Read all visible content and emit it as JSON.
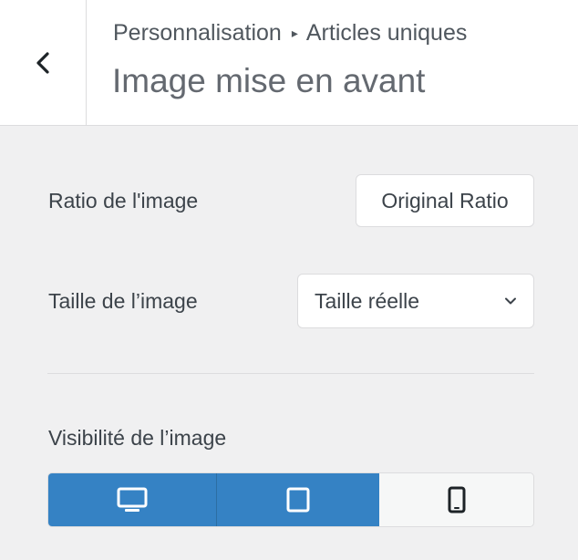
{
  "header": {
    "breadcrumb_parent": "Personnalisation",
    "breadcrumb_separator": "▸",
    "breadcrumb_current": "Articles uniques",
    "title": "Image mise en avant",
    "back_icon": "chevron-left-icon"
  },
  "ratio": {
    "label": "Ratio de l'image",
    "button_label": "Original Ratio"
  },
  "size": {
    "label": "Taille de l’image",
    "selected": "Taille réelle",
    "icon": "chevron-down-icon"
  },
  "visibility": {
    "label": "Visibilité de l’image",
    "devices": [
      {
        "name": "desktop",
        "icon": "desktop-icon",
        "active": true
      },
      {
        "name": "tablet",
        "icon": "tablet-icon",
        "active": true
      },
      {
        "name": "mobile",
        "icon": "mobile-icon",
        "active": false
      }
    ]
  },
  "colors": {
    "accent": "#3582c4",
    "panel_bg": "#f0f0f1",
    "header_bg": "#ffffff"
  }
}
